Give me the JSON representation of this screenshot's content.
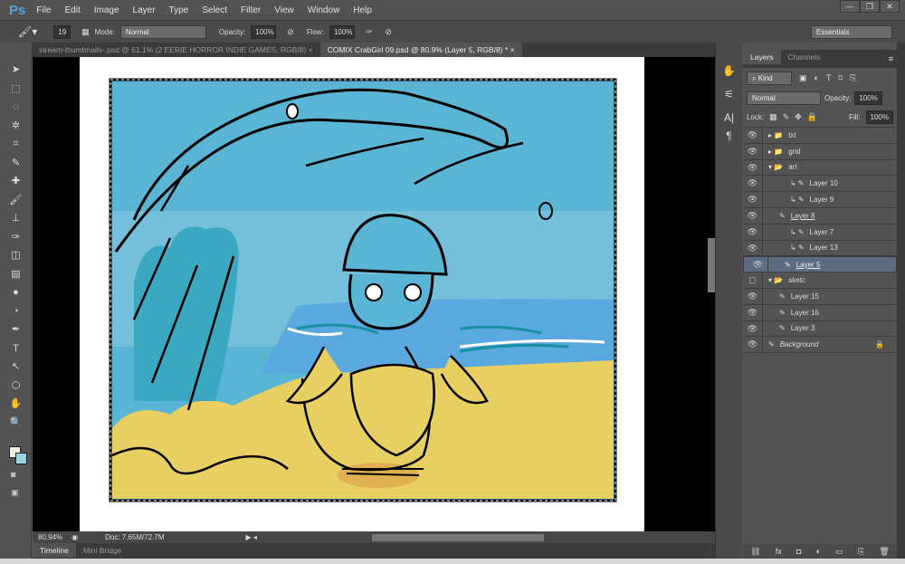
{
  "app": {
    "logo": "Ps",
    "menus": [
      "File",
      "Edit",
      "Image",
      "Layer",
      "Type",
      "Select",
      "Filter",
      "View",
      "Window",
      "Help"
    ],
    "window_buttons": [
      "—",
      "❐",
      "✕"
    ]
  },
  "options": {
    "brush_size": "19",
    "mode_label": "Mode:",
    "mode_value": "Normal",
    "opacity_label": "Opacity:",
    "opacity_value": "100%",
    "flow_label": "Flow:",
    "flow_value": "100%",
    "workspace": "Essentials"
  },
  "tabs": [
    {
      "label": "stream-thumbnails-.psd @ 61.1% (2 EERIE HORROR INDIE GAMES, RGB/8)",
      "close": "×"
    },
    {
      "label": "COMIX CrabGirl 09.psd @ 80.9% (Layer 5, RGB/8) *",
      "close": "×"
    }
  ],
  "tools": [
    "➤",
    "⬚",
    "◌",
    "✲",
    "⌗",
    "✎",
    "✚",
    "🖌",
    "⊥",
    "✑",
    "◫",
    "▤",
    "●",
    "◔",
    "✒",
    "T",
    "↖",
    "⬡",
    "✋",
    "🔍"
  ],
  "status": {
    "zoom": "80.94%",
    "doc": "Doc: 7.65M/72.7M"
  },
  "bottom_tabs": [
    "Timeline",
    "Mini Bridge"
  ],
  "layers_panel": {
    "tabs": [
      "Layers",
      "Channels"
    ],
    "filter": "Kind",
    "blend": "Normal",
    "opacity_label": "Opacity:",
    "opacity": "100%",
    "lock_label": "Lock:",
    "fill_label": "Fill:",
    "fill": "100%",
    "layers": [
      {
        "name": "txt",
        "type": "group",
        "indent": 0,
        "visible": true
      },
      {
        "name": "grid",
        "type": "group",
        "indent": 0,
        "visible": true
      },
      {
        "name": "art",
        "type": "group-open",
        "indent": 0,
        "visible": true
      },
      {
        "name": "Layer 10",
        "type": "clip",
        "indent": 2,
        "visible": true
      },
      {
        "name": "Layer 9",
        "type": "clip",
        "indent": 2,
        "visible": true
      },
      {
        "name": "Layer 8",
        "type": "layer",
        "indent": 1,
        "visible": true
      },
      {
        "name": "Layer 7",
        "type": "clip",
        "indent": 2,
        "visible": true
      },
      {
        "name": "Layer 13",
        "type": "clip",
        "indent": 2,
        "visible": true
      },
      {
        "name": "Layer 5",
        "type": "layer",
        "indent": 1,
        "visible": true,
        "selected": true
      },
      {
        "name": "sketc",
        "type": "group-open",
        "indent": 0,
        "visible": false
      },
      {
        "name": "Layer 15",
        "type": "layer",
        "indent": 1,
        "visible": true
      },
      {
        "name": "Layer 16",
        "type": "layer",
        "indent": 1,
        "visible": true
      },
      {
        "name": "Layer 3",
        "type": "layer",
        "indent": 1,
        "visible": true
      },
      {
        "name": "Background",
        "type": "background",
        "indent": 0,
        "visible": true
      }
    ]
  },
  "colors": {
    "sky": "#5ab4d4",
    "sand": "#e8cf62",
    "sea": "#5aa8e0",
    "wave": "#3aa8c0"
  }
}
